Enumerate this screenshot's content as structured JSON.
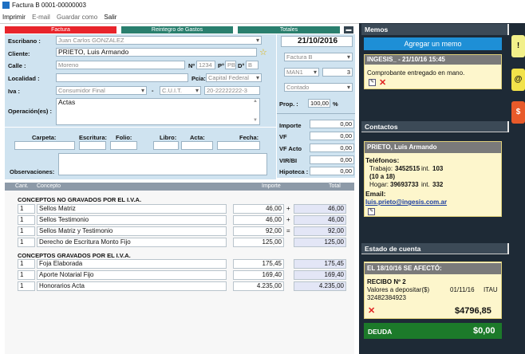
{
  "window": {
    "title": "Factura B 0001-00000003"
  },
  "menu": [
    "Imprimir",
    "E-mail",
    "Guardar como",
    "Salir"
  ],
  "tabs": {
    "factura": "Factura",
    "reintegro": "Reintegro de Gastos",
    "totales": "Totales"
  },
  "form": {
    "escribano_label": "Escribano :",
    "escribano": "Juan Carlos GONZALEZ",
    "cliente_label": "Cliente:",
    "cliente": "PRIETO, Luis Armando",
    "calle_label": "Calle :",
    "calle": "Moreno",
    "nro_label": "Nº",
    "nro": "1234",
    "piso_label": "P°",
    "piso": "PB",
    "dpto_label": "D°",
    "dpto": "B",
    "localidad_label": "Localidad :",
    "pcia_label": "Pcia:",
    "pcia": "Capital Federal",
    "iva_label": "Iva :",
    "iva": "Consumidor Final",
    "dash": "-",
    "doc_tipo": "C.U.I.T.",
    "doc_nro": "20-22222222-3",
    "operacion_label": "Operación(es) :",
    "operacion": "Actas"
  },
  "right": {
    "fecha": "21/10/2016",
    "tipo": "Factura B",
    "talonario": "MAN1",
    "numero": "3",
    "condicion": "Contado",
    "prop_label": "Prop. :",
    "prop": "100,00",
    "prop_unit": "%",
    "importe_label": "Importe",
    "importe": "0,00",
    "vf_label": "VF",
    "vf": "0,00",
    "vfacto_label": "VF Acto",
    "vfacto": "0,00",
    "virbi_label": "VIR/BI",
    "virbi": "0,00",
    "hipoteca_label": "Hipoteca :",
    "hipoteca": "0,00"
  },
  "escritura": {
    "carpeta": "Carpeta:",
    "escritura": "Escritura:",
    "folio": "Folio:",
    "libro": "Libro:",
    "acta": "Acta:",
    "fecha": "Fecha:",
    "observaciones": "Observaciones:"
  },
  "table": {
    "cant": "Cant.",
    "concepto": "Concepto",
    "importe": "Importe",
    "total": "Total"
  },
  "sections": [
    {
      "title": "CONCEPTOS NO GRAVADOS POR EL I.V.A.",
      "rows": [
        {
          "cant": "1",
          "concepto": "Sellos Matriz",
          "importe": "46,00",
          "op": "+",
          "total": "46,00"
        },
        {
          "cant": "1",
          "concepto": "Sellos Testimonio",
          "importe": "46,00",
          "op": "+",
          "total": "46,00"
        },
        {
          "cant": "1",
          "concepto": "Sellos Matriz y Testimonio",
          "importe": "92,00",
          "op": "=",
          "total": "92,00"
        },
        {
          "cant": "1",
          "concepto": "Derecho de Escritura Monto Fijo",
          "importe": "125,00",
          "op": "",
          "total": "125,00"
        }
      ]
    },
    {
      "title": "CONCEPTOS GRAVADOS POR EL I.V.A.",
      "rows": [
        {
          "cant": "1",
          "concepto": "Foja Elaborada",
          "importe": "175,45",
          "op": "",
          "total": "175,45"
        },
        {
          "cant": "1",
          "concepto": "Aporte Notarial Fijo",
          "importe": "169,40",
          "op": "",
          "total": "169,40"
        },
        {
          "cant": "1",
          "concepto": "Honorarios Acta",
          "importe": "4.235,00",
          "op": "",
          "total": "4.235,00"
        }
      ]
    }
  ],
  "sidebar": {
    "memos_title": "Memos",
    "add_memo": "Agregar un memo",
    "memo_header": "INGESIS_ - 21/10/16 15:45",
    "memo_text": "Comprobante entregado en mano.",
    "contactos_title": "Contactos",
    "contact_name": "PRIETO, Luis Armando",
    "telefonos_label": "Teléfonos:",
    "trabajo_label": "Trabajo:",
    "trabajo": "3452515",
    "trabajo_int_label": "int.",
    "trabajo_int": "103",
    "trabajo_extra": "(10 a 18)",
    "hogar_label": "Hogar:",
    "hogar": "39693733",
    "hogar_int_label": "int.",
    "hogar_int": "332",
    "email_label": "Email:",
    "email": "luis.prieto@ingesis.com.ar",
    "estado_title": "Estado de cuenta",
    "afecto": "EL 18/10/16 SE AFECTÓ:",
    "recibo": "RECIBO Nº 2",
    "valores": "Valores a depositar($)",
    "valores_fecha": "01/11/16",
    "valores_banco": "ITAU",
    "valores_nro": "32482384923",
    "monto": "$4796,85",
    "deuda_label": "DEUDA",
    "deuda": "$0,00",
    "colors": {
      "accent": "#1e8fd6",
      "deuda_bg": "#1c7a2a",
      "side_bg": "#1e2a36"
    }
  }
}
